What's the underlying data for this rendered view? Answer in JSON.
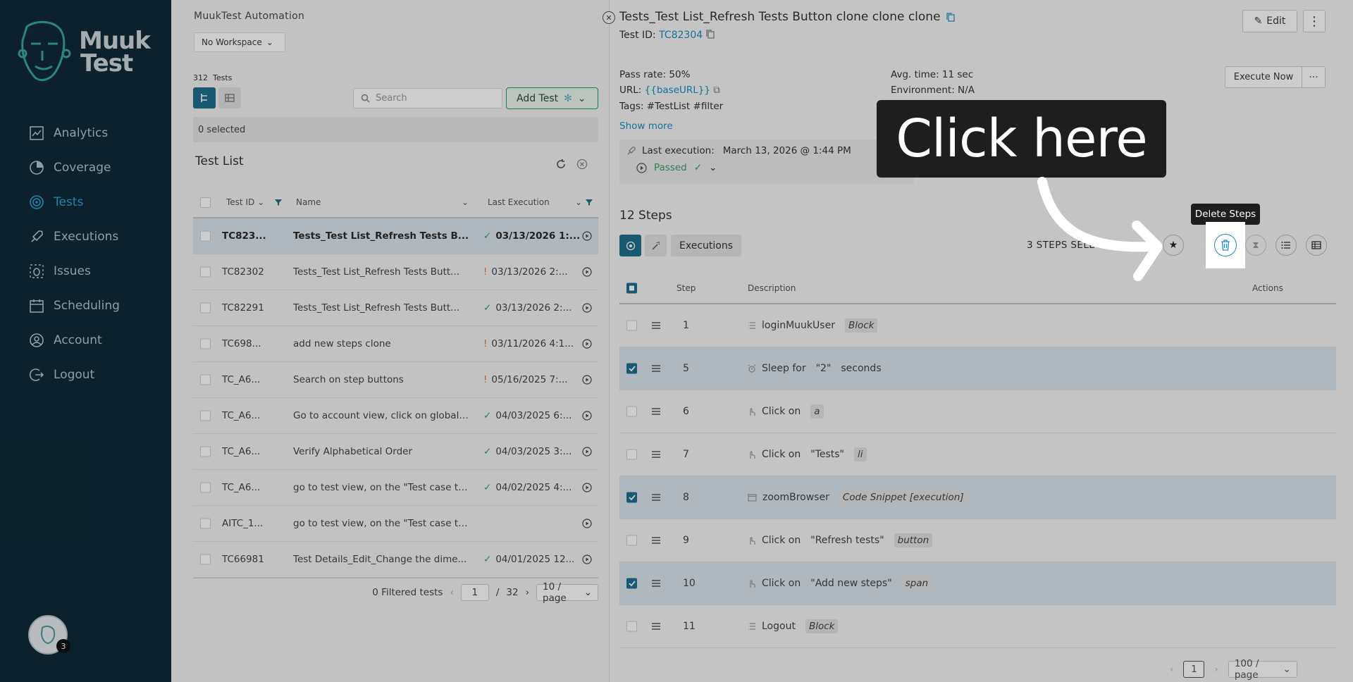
{
  "sidebar": {
    "logo": {
      "line1": "Muuk",
      "line2": "Test"
    },
    "items": [
      {
        "label": "Analytics",
        "icon": "analytics-icon"
      },
      {
        "label": "Coverage",
        "icon": "coverage-icon"
      },
      {
        "label": "Tests",
        "icon": "tests-icon"
      },
      {
        "label": "Executions",
        "icon": "rocket-icon"
      },
      {
        "label": "Issues",
        "icon": "bug-icon"
      },
      {
        "label": "Scheduling",
        "icon": "calendar-icon"
      },
      {
        "label": "Account",
        "icon": "user-icon"
      },
      {
        "label": "Logout",
        "icon": "logout-icon"
      }
    ],
    "active_item": "Tests",
    "avatar_badge": "3"
  },
  "middle": {
    "app_name": "MuukTest Automation",
    "workspace": "No Workspace",
    "test_count": "312",
    "test_count_label": "Tests",
    "search_placeholder": "Search",
    "add_test_label": "Add Test",
    "selected_text": "0 selected",
    "list_title": "Test List",
    "columns": {
      "id": "Test ID",
      "name": "Name",
      "last_execution": "Last Execution"
    },
    "rows": [
      {
        "id": "TC823...",
        "name": "Tests_Test List_Refresh Tests B...",
        "exec": "03/13/2026 1:...",
        "status": "ok",
        "selected": true
      },
      {
        "id": "TC82302",
        "name": "Tests_Test List_Refresh Tests Butt...",
        "exec": "03/13/2026 2:...",
        "status": "warn",
        "selected": false
      },
      {
        "id": "TC82291",
        "name": "Tests_Test List_Refresh Tests Butt...",
        "exec": "03/13/2026 2:...",
        "status": "ok",
        "selected": false
      },
      {
        "id": "TC698...",
        "name": "add new steps clone",
        "exec": "03/11/2026 4:1...",
        "status": "warn",
        "selected": false
      },
      {
        "id": "TC_A6...",
        "name": "Search on step buttons",
        "exec": "05/16/2025 7:...",
        "status": "warn",
        "selected": false
      },
      {
        "id": "TC_A6...",
        "name": "Go to account view, click on global v...",
        "exec": "04/03/2025 6:...",
        "status": "ok",
        "selected": false
      },
      {
        "id": "TC_A6...",
        "name": "Verify Alphabetical Order",
        "exec": "04/03/2025 3:...",
        "status": "ok",
        "selected": false
      },
      {
        "id": "TC_A6...",
        "name": "go to test view, on the \"Test case to ...",
        "exec": "04/02/2025 4:...",
        "status": "ok",
        "selected": false
      },
      {
        "id": "AITC_1...",
        "name": "go to test view, on the \"Test case to ...",
        "exec": "",
        "status": "none",
        "selected": false
      },
      {
        "id": "TC66981",
        "name": "Test Details_Edit_Change the dime...",
        "exec": "04/01/2025 12...",
        "status": "ok",
        "selected": false
      }
    ],
    "pager": {
      "filtered": "0 Filtered tests",
      "page": "1",
      "sep": "/",
      "total": "32",
      "per_page": "10 / page"
    }
  },
  "detail": {
    "title": "Tests_Test List_Refresh Tests Button clone clone clone",
    "test_id_label": "Test ID:",
    "test_id": "TC82304",
    "edit_label": "Edit",
    "pass_rate": "Pass rate: 50%",
    "url_label": "URL:",
    "url_value": "{{baseURL}}",
    "tags": "Tags: #TestList #filter",
    "show_more": "Show more",
    "avg_time": "Avg. time: 11 sec",
    "environment": "Environment: N/A",
    "execute_now": "Execute Now",
    "last_execution_label": "Last execution:",
    "last_execution_value": "March 13, 2026 @ 1:44 PM",
    "last_status": "Passed",
    "steps_title": "12 Steps",
    "executions_tab": "Executions",
    "steps_selected": "3 STEPS SELE",
    "columns": {
      "step": "Step",
      "description": "Description",
      "actions": "Actions"
    },
    "steps": [
      {
        "num": "1",
        "checked": false,
        "icon": "list-icon",
        "parts": [
          "loginMuukUser"
        ],
        "tag": "Block"
      },
      {
        "num": "5",
        "checked": true,
        "icon": "alarm-icon",
        "parts": [
          "Sleep for",
          "\"2\"",
          "seconds"
        ],
        "tag": ""
      },
      {
        "num": "6",
        "checked": false,
        "icon": "pointer-icon",
        "parts": [
          "Click on"
        ],
        "tag": "a"
      },
      {
        "num": "7",
        "checked": false,
        "icon": "pointer-icon",
        "parts": [
          "Click on",
          "\"Tests\""
        ],
        "tag": "li"
      },
      {
        "num": "8",
        "checked": true,
        "icon": "window-icon",
        "parts": [
          "zoomBrowser"
        ],
        "tag": "Code Snippet [execution]"
      },
      {
        "num": "9",
        "checked": false,
        "icon": "pointer-icon",
        "parts": [
          "Click on",
          "\"Refresh tests\""
        ],
        "tag": "button"
      },
      {
        "num": "10",
        "checked": true,
        "icon": "pointer-icon",
        "parts": [
          "Click on",
          "\"Add new steps\""
        ],
        "tag": "span"
      },
      {
        "num": "11",
        "checked": false,
        "icon": "list-icon",
        "parts": [
          "Logout"
        ],
        "tag": "Block"
      }
    ],
    "pager": {
      "page": "1",
      "per_page": "100 / page"
    }
  },
  "overlay": {
    "callout": "Click here",
    "tooltip": "Delete Steps"
  },
  "colors": {
    "sidebar_bg": "#0f2a36",
    "accent": "#1e6f8c",
    "link": "#1a8fc0",
    "ok": "#3aa16b",
    "warn": "#e07a3c"
  }
}
